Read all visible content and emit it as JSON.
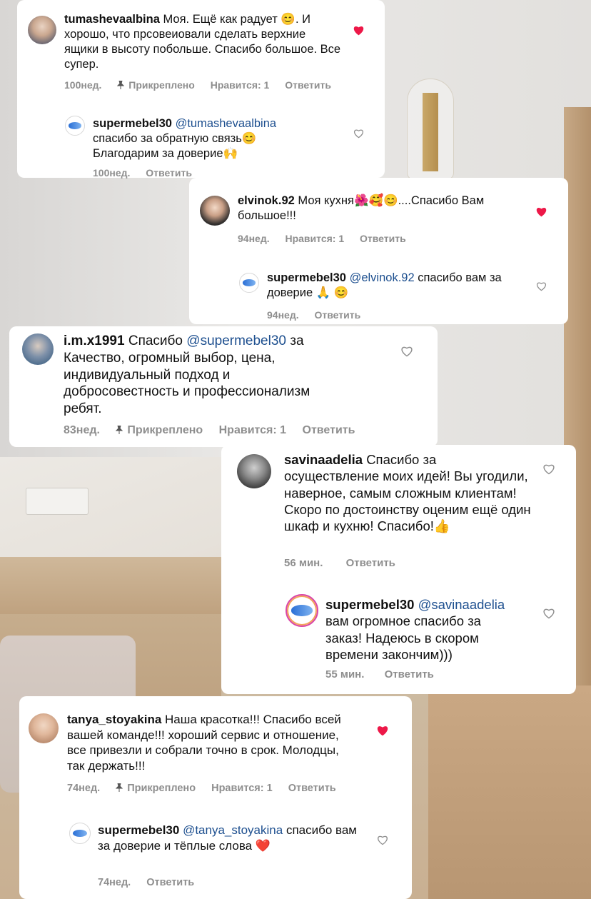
{
  "comments": [
    {
      "username": "tumashevaalbina",
      "text": "Моя. Ещё как радует 😊. И хорошо, что прсовеиовали сделать верхние ящики в высоту побольше. Спасибо большое. Все супер.",
      "time": "100нед.",
      "pinned": "Прикреплено",
      "likes": "Нравится: 1",
      "reply": "Ответить",
      "liked": true,
      "response": {
        "username": "supermebel30",
        "mention": "@tumashevaalbina",
        "text": "спасибо за обратную связь😊 Благодарим за доверие🙌",
        "time": "100нед.",
        "reply": "Ответить"
      }
    },
    {
      "username": "elvinok.92",
      "text": "Моя кухня🌺🥰😊....Спасибо Вам большое!!!",
      "time": "94нед.",
      "likes": "Нравится: 1",
      "reply": "Ответить",
      "liked": true,
      "response": {
        "username": "supermebel30",
        "mention": "@elvinok.92",
        "text": "спасибо вам за доверие 🙏 😊",
        "time": "94нед.",
        "reply": "Ответить"
      }
    },
    {
      "username": "i.m.x1991",
      "text_before": "Спасибо",
      "mention": "@supermebel30",
      "text_after": "за Качество, огромный выбор, цена, индивидуальный подход и добросовестность и профессионализм ребят.",
      "time": "83нед.",
      "pinned": "Прикреплено",
      "likes": "Нравится: 1",
      "reply": "Ответить",
      "liked": false
    },
    {
      "username": "savinaadelia",
      "text": "Спасибо за осуществление моих идей! Вы угодили, наверное, самым  сложным клиентам! Скоро по достоинству оценим ещё один шкаф и кухню! Спасибо!👍",
      "time": "56 мин.",
      "reply": "Ответить",
      "liked": false,
      "response": {
        "username": "supermebel30",
        "mention": "@savinaadelia",
        "text": "вам огромное спасибо за заказ! Надеюсь в скором времени закончим)))",
        "time": "55 мин.",
        "reply": "Ответить"
      }
    },
    {
      "username": "tanya_stoyakina",
      "text": "Наша красотка!!! Спасибо всей вашей команде!!! хороший сервис и отношение, все привезли и собрали точно в срок. Молодцы, так держать!!!",
      "time": "74нед.",
      "pinned": "Прикреплено",
      "likes": "Нравится: 1",
      "reply": "Ответить",
      "liked": true,
      "response": {
        "username": "supermebel30",
        "mention": "@tanya_stoyakina",
        "text": "спасибо вам за доверие и тёплые слова ❤️",
        "time": "74нед.",
        "reply": "Ответить"
      }
    }
  ],
  "colors": {
    "heart_liked": "#ed1848",
    "heart_empty": "#8e8e8e",
    "meta": "#8e8e8e",
    "mention": "#1d4f8f"
  },
  "icons": [
    "heart-icon",
    "pin-icon",
    "avatar"
  ]
}
